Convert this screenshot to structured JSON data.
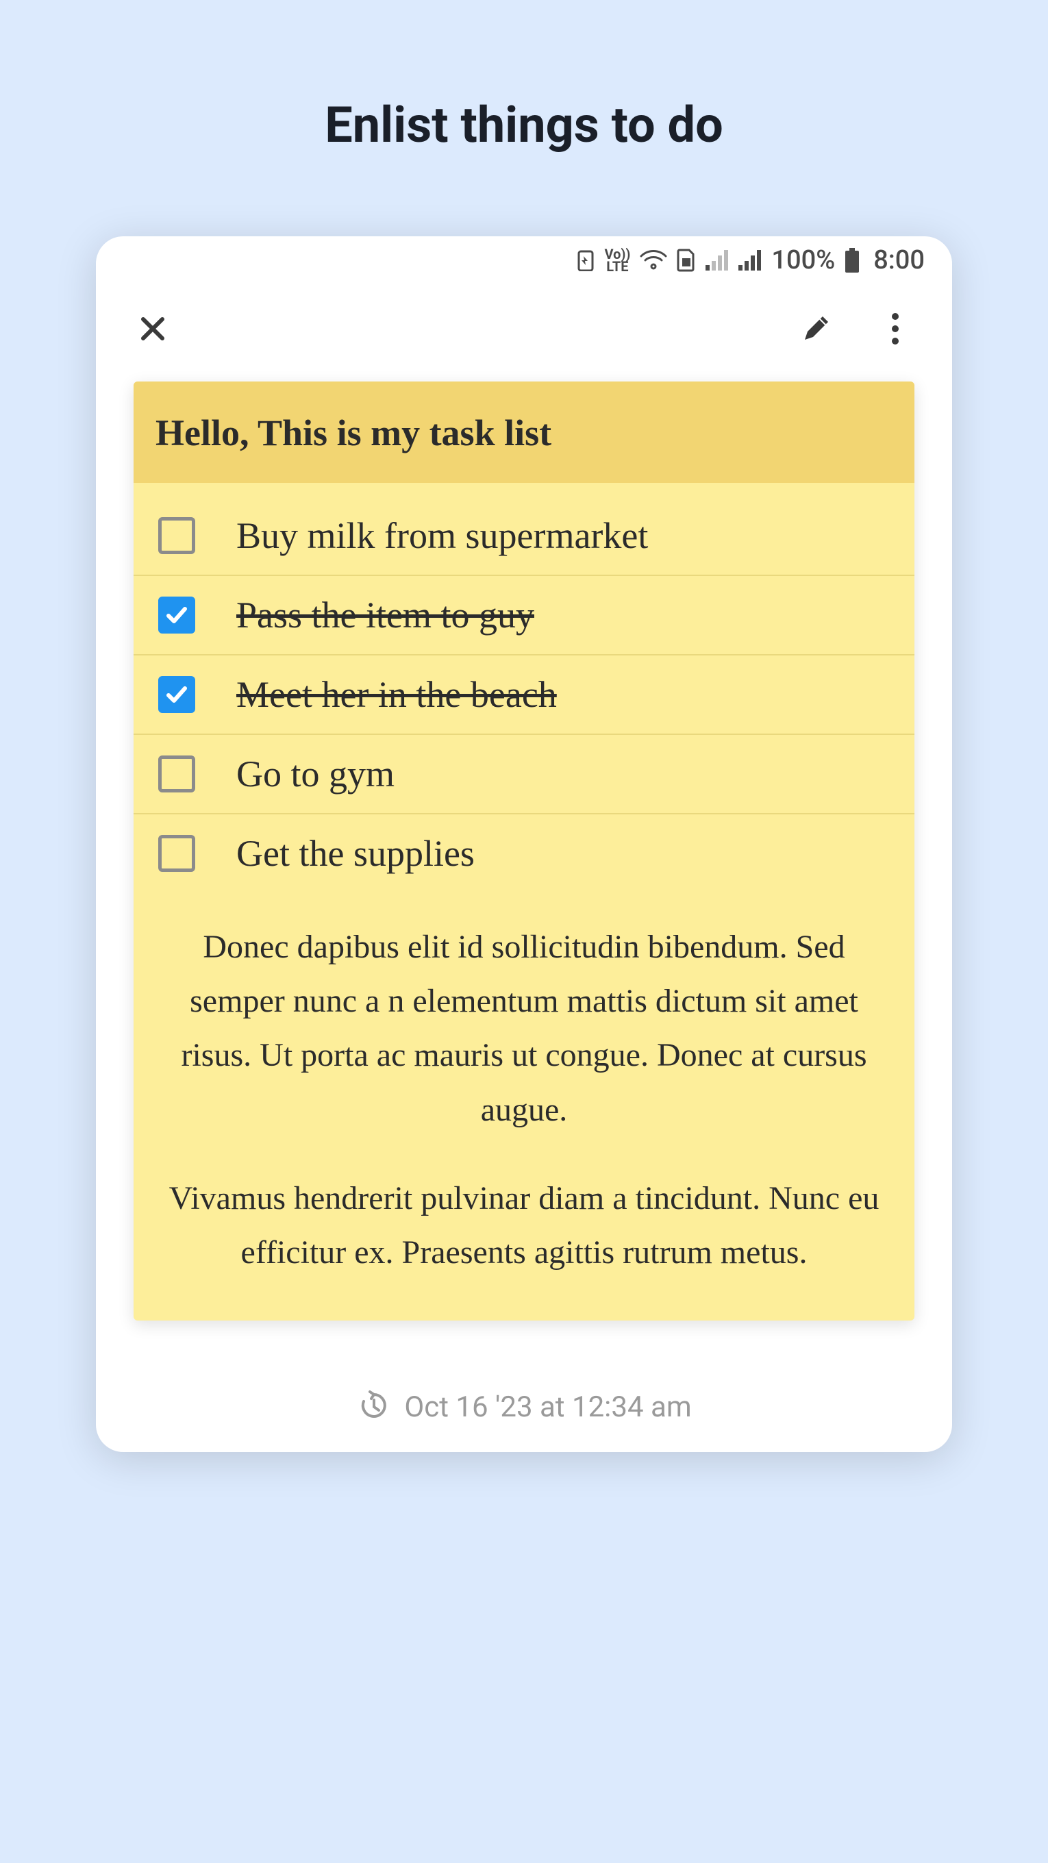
{
  "page": {
    "title": "Enlist things to do"
  },
  "statusbar": {
    "battery_pct": "100%",
    "time": "8:00"
  },
  "note": {
    "title": "Hello, This is my task list",
    "tasks": [
      {
        "label": "Buy milk from supermarket",
        "done": false
      },
      {
        "label": "Pass the item to guy",
        "done": true
      },
      {
        "label": "Meet her in the beach",
        "done": true
      },
      {
        "label": "Go to gym",
        "done": false
      },
      {
        "label": "Get the supplies",
        "done": false
      }
    ],
    "paragraphs": [
      "Donec dapibus elit id sollicitudin bibendum. Sed semper nunc a n elementum mattis dictum sit amet risus. Ut porta ac mauris ut congue. Donec at cursus augue.",
      "Vivamus hendrerit pulvinar diam a tincidunt. Nunc eu efficitur ex. Praesents agittis rutrum metus."
    ],
    "timestamp": "Oct 16 '23 at 12:34 am"
  }
}
